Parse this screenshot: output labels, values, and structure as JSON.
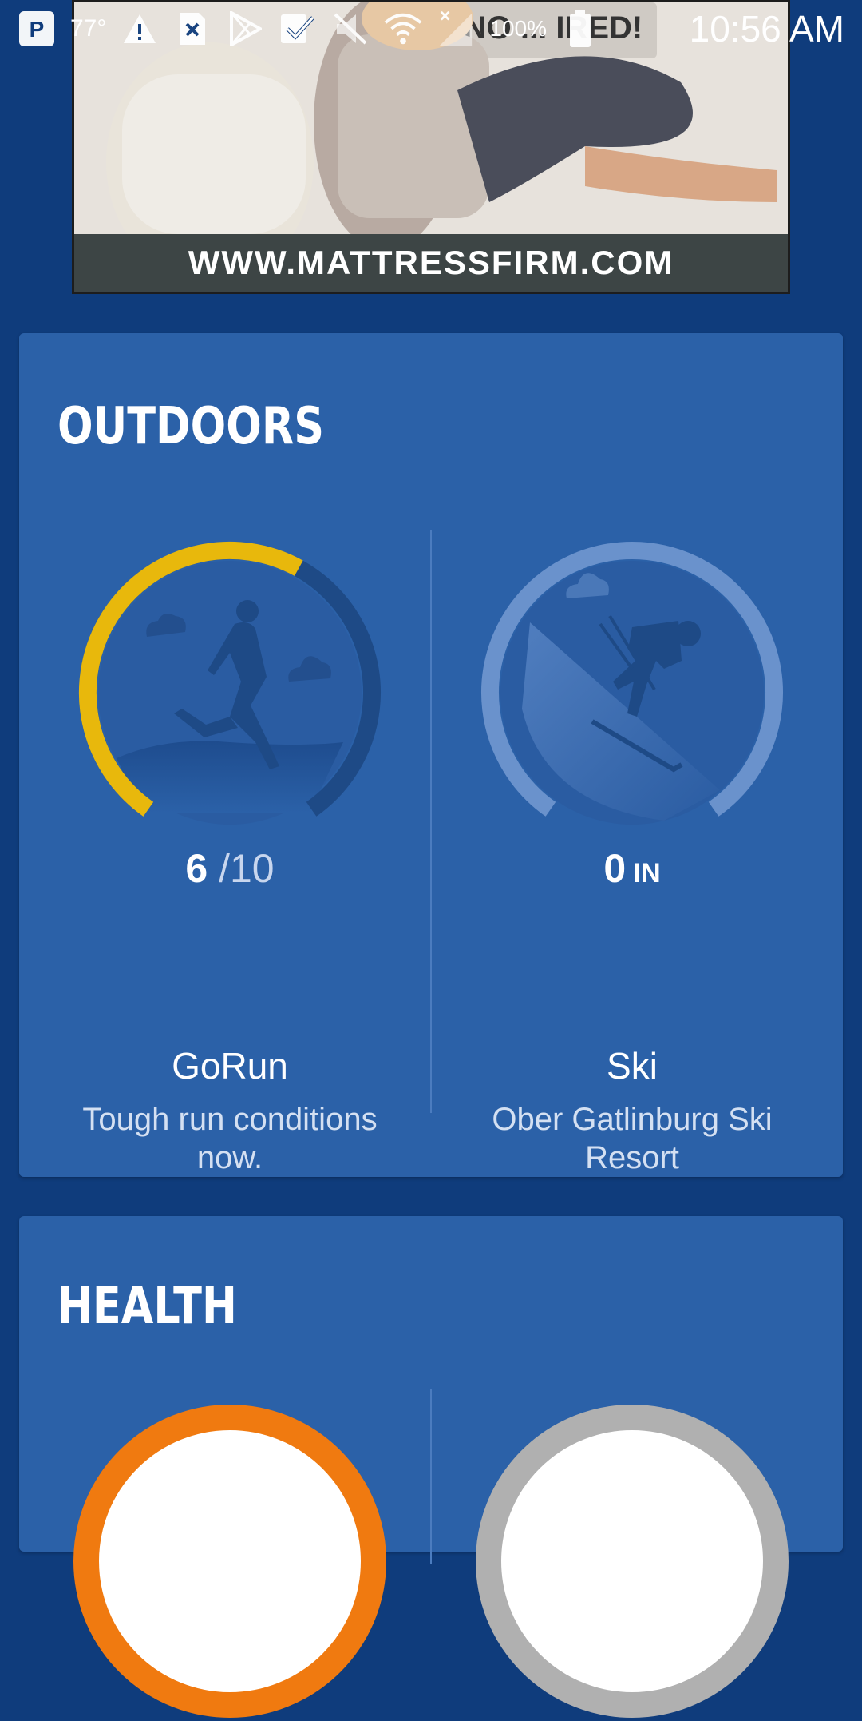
{
  "status_bar": {
    "temperature": "77°",
    "battery": "100%",
    "time": "10:56 AM",
    "icons": [
      "pandora-icon",
      "warning-icon",
      "sim-error-icon",
      "play-store-icon",
      "check-icon",
      "mute-icon",
      "wifi-icon",
      "signal-icon",
      "battery-icon"
    ]
  },
  "ad": {
    "url_text": "WWW.MATTRESSFIRM.COM",
    "overlay_text": "NO ... IRED!"
  },
  "outdoors": {
    "title": "OUTDOORS",
    "run": {
      "score": "6",
      "score_max": " /10",
      "progress": 0.6,
      "name": "GoRun",
      "description": "Tough run conditions now.",
      "accent": "#e8b80c"
    },
    "ski": {
      "value": "0",
      "unit": " IN",
      "name": "Ski",
      "description": "Ober Gatlinburg Ski Resort"
    }
  },
  "health": {
    "title": "HEALTH",
    "left_accent": "#f07a10",
    "right_accent": "#b0b0b0"
  },
  "colors": {
    "background": "#0f3c7c",
    "card": "#2b61a8"
  }
}
